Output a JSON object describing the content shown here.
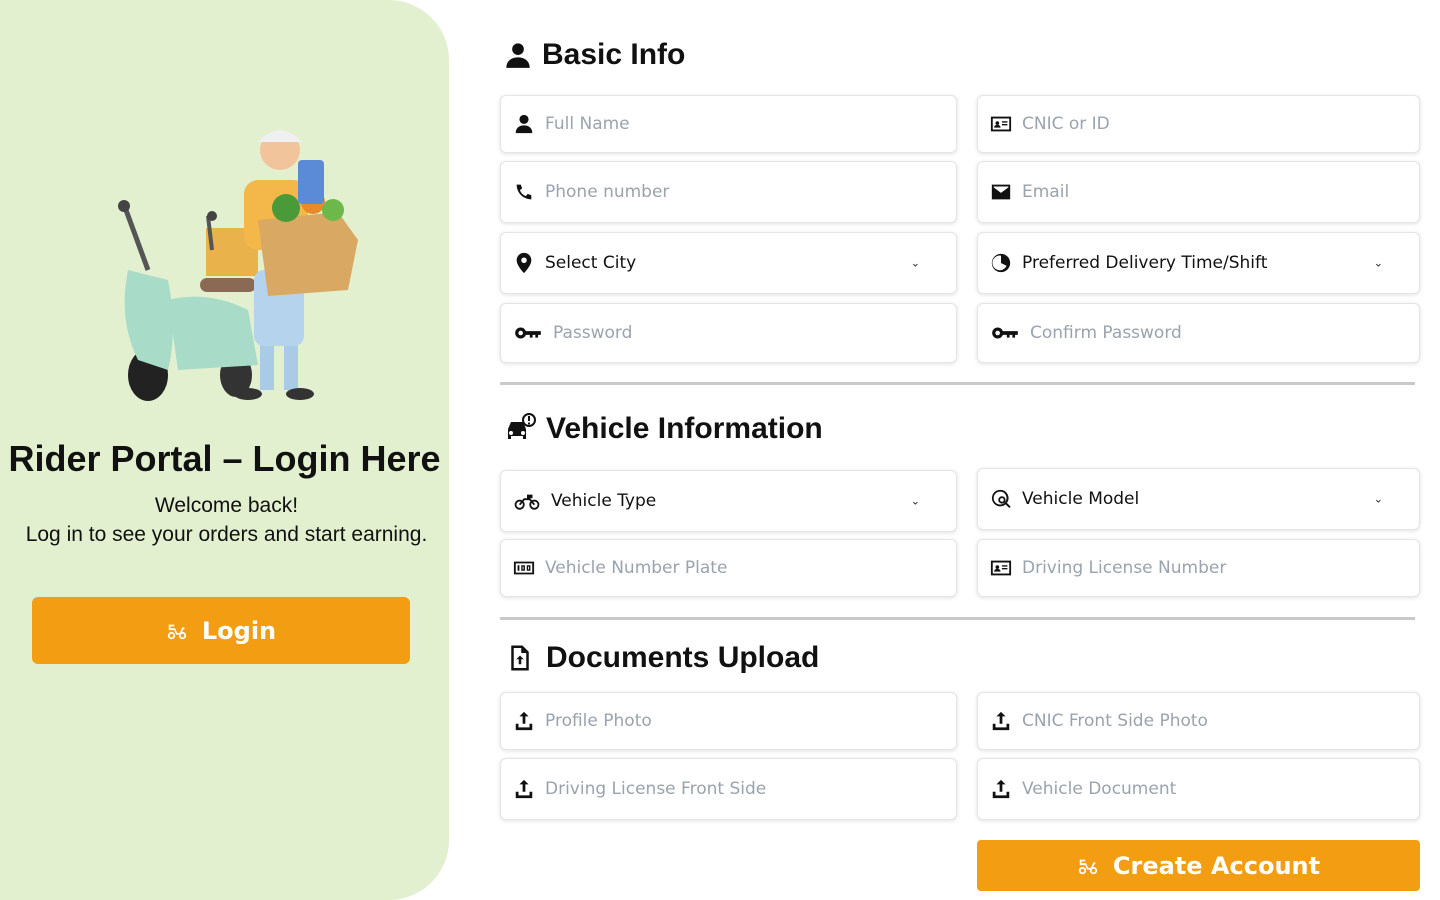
{
  "left": {
    "title": "Rider Portal – Login Here",
    "welcome": "Welcome back!",
    "subtitle": "Log in to see your orders and start earning.",
    "login_label": "Login",
    "illustration_icon": "delivery-rider-scooter-illustration"
  },
  "basic_info": {
    "title": "Basic Info",
    "full_name": "Full Name",
    "cnic": "CNIC or ID",
    "phone": "Phone number",
    "email": "Email",
    "city": "Select City",
    "shift": "Preferred Delivery Time/Shift",
    "password": "Password",
    "confirm_password": "Confirm Password"
  },
  "vehicle": {
    "title": "Vehicle Information",
    "type": "Vehicle Type",
    "model": "Vehicle Model",
    "plate": "Vehicle Number Plate",
    "license_number": "Driving License Number"
  },
  "documents": {
    "title": "Documents Upload",
    "profile_photo": "Profile Photo",
    "cnic_front": "CNIC Front Side Photo",
    "license_front": "Driving License Front Side",
    "vehicle_document": "Vehicle Document"
  },
  "create_account_label": "Create Account",
  "colors": {
    "accent": "#f29d12",
    "panel": "#e2f0d0",
    "placeholder": "#9aa3ad"
  }
}
